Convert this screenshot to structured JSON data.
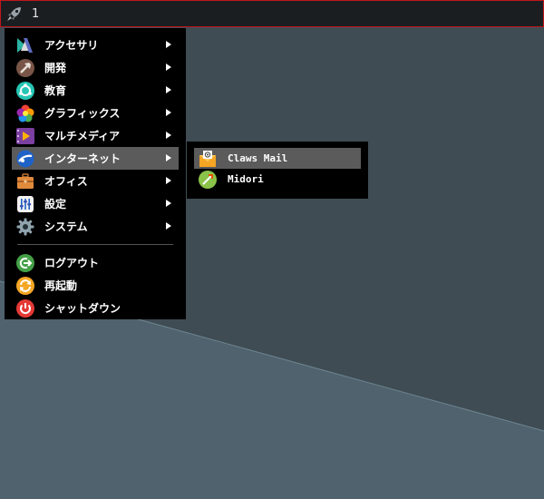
{
  "taskbar": {
    "launcher_icon": "rocket-icon",
    "workspace": "1"
  },
  "menu": {
    "items": [
      {
        "label": "アクセサリ",
        "icon": "accessories-icon"
      },
      {
        "label": "開発",
        "icon": "development-icon"
      },
      {
        "label": "教育",
        "icon": "education-icon"
      },
      {
        "label": "グラフィックス",
        "icon": "graphics-icon"
      },
      {
        "label": "マルチメディア",
        "icon": "multimedia-icon"
      },
      {
        "label": "インターネット",
        "icon": "internet-icon",
        "active": true
      },
      {
        "label": "オフィス",
        "icon": "office-icon"
      },
      {
        "label": "設定",
        "icon": "settings-icon"
      },
      {
        "label": "システム",
        "icon": "system-icon"
      }
    ],
    "actions": [
      {
        "label": "ログアウト",
        "icon": "logout-icon"
      },
      {
        "label": "再起動",
        "icon": "reboot-icon"
      },
      {
        "label": "シャットダウン",
        "icon": "shutdown-icon"
      }
    ]
  },
  "submenu": {
    "items": [
      {
        "label": "Claws Mail",
        "icon": "mail-icon",
        "active": true
      },
      {
        "label": "Midori",
        "icon": "midori-icon"
      }
    ]
  },
  "colors": {
    "accent_border": "#c0161b",
    "highlight": "#5b5b5b",
    "menu_bg": "#000000"
  }
}
